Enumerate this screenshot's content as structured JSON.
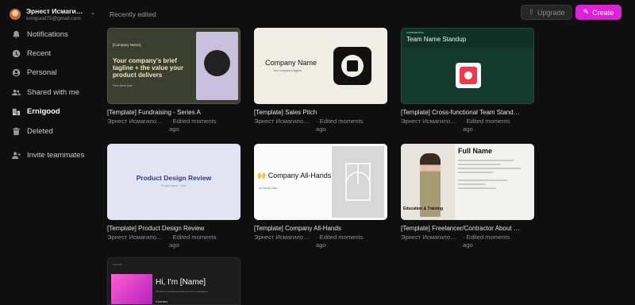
{
  "user": {
    "name": "Эрнест Исмаги…",
    "email": "ernigood75@gmail.com"
  },
  "sidebar": {
    "items": [
      {
        "label": "Notifications",
        "icon": "bell-icon"
      },
      {
        "label": "Recent",
        "icon": "clock-icon"
      },
      {
        "label": "Personal",
        "icon": "user-icon"
      },
      {
        "label": "Shared with me",
        "icon": "people-icon"
      },
      {
        "label": "Ernigood",
        "icon": "building-icon",
        "active": true
      },
      {
        "label": "Deleted",
        "icon": "trash-icon"
      },
      {
        "label": "Invite teammates",
        "icon": "add-user-icon"
      }
    ]
  },
  "header": {
    "section_title": "Recently edited",
    "upgrade_label": "Upgrade",
    "create_label": "Create"
  },
  "colors": {
    "accent": "#e020d8",
    "background": "#0f0f0f"
  },
  "cards": [
    {
      "title": "[Template] Fundraising - Series A",
      "author": "Эрнест Исмагило…",
      "edited": "· Edited moments ago",
      "thumb": {
        "label": "[Company Name]",
        "heading": "Your company's brief tagline + the value your product delivers",
        "small": "Pitch Deck Date"
      }
    },
    {
      "title": "[Template] Sales Pitch",
      "author": "Эрнест Исмагило…",
      "edited": "· Edited moments ago",
      "thumb": {
        "heading": "Company Name",
        "sub": "Your company's tagline"
      }
    },
    {
      "title": "[Template] Cross-functional Team Stand…",
      "author": "Эрнест Исмагило…",
      "edited": "· Edited moments ago",
      "thumb": {
        "tiny": "CONFIDENTIAL",
        "heading": "Team Name Standup"
      }
    },
    {
      "title": "[Template] Product Design Review",
      "author": "Эрнест Исмагило…",
      "edited": "· Edited moments ago",
      "thumb": {
        "heading": "Product Design Review",
        "sub": "Project Name · Date"
      }
    },
    {
      "title": "[Template] Company All-Hands",
      "author": "Эрнест Исмагило…",
      "edited": "· Edited moments ago",
      "thumb": {
        "heading": "🙌 Company All-Hands",
        "sub": "All Hands Date"
      }
    },
    {
      "title": "[Template] Freelancer/Contractor About …",
      "author": "Эрнест Исмагило…",
      "edited": "· Edited moments ago",
      "thumb": {
        "heading": "Full Name",
        "edu": "Education & Training"
      }
    },
    {
      "title": "",
      "author": "",
      "edited": "",
      "thumb": {
        "top": "Press Kit",
        "heading": "Hi, I'm [Name]",
        "sub": "Introduce yourself and what you do in a sentence.",
        "connect": "Connect"
      }
    }
  ]
}
